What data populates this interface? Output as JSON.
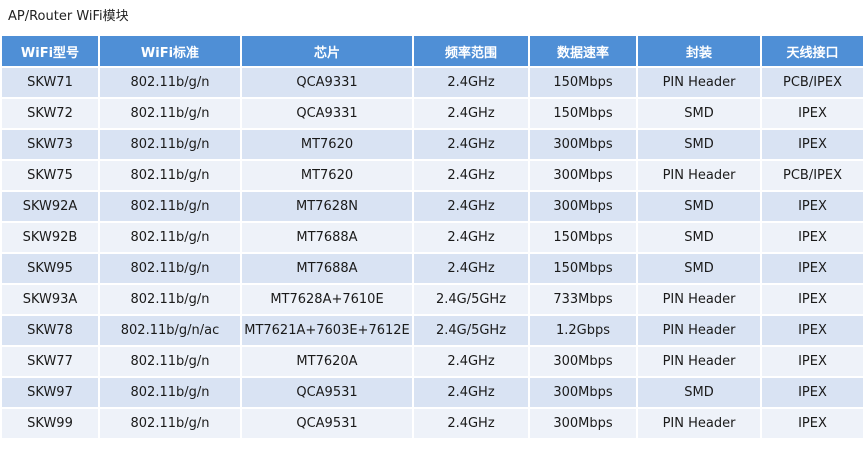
{
  "title": "AP/Router WiFi模块",
  "table": {
    "columns": [
      "WiFi型号",
      "WiFi标准",
      "芯片",
      "频率范围",
      "数据速率",
      "封装",
      "天线接口"
    ],
    "rows": [
      [
        "SKW71",
        "802.11b/g/n",
        "QCA9331",
        "2.4GHz",
        "150Mbps",
        "PIN Header",
        "PCB/IPEX"
      ],
      [
        "SKW72",
        "802.11b/g/n",
        "QCA9331",
        "2.4GHz",
        "150Mbps",
        "SMD",
        "IPEX"
      ],
      [
        "SKW73",
        "802.11b/g/n",
        "MT7620",
        "2.4GHz",
        "300Mbps",
        "SMD",
        "IPEX"
      ],
      [
        "SKW75",
        "802.11b/g/n",
        "MT7620",
        "2.4GHz",
        "300Mbps",
        "PIN Header",
        "PCB/IPEX"
      ],
      [
        "SKW92A",
        "802.11b/g/n",
        "MT7628N",
        "2.4GHz",
        "300Mbps",
        "SMD",
        "IPEX"
      ],
      [
        "SKW92B",
        "802.11b/g/n",
        "MT7688A",
        "2.4GHz",
        "150Mbps",
        "SMD",
        "IPEX"
      ],
      [
        "SKW95",
        "802.11b/g/n",
        "MT7688A",
        "2.4GHz",
        "150Mbps",
        "SMD",
        "IPEX"
      ],
      [
        "SKW93A",
        "802.11b/g/n",
        "MT7628A+7610E",
        "2.4G/5GHz",
        "733Mbps",
        "PIN Header",
        "IPEX"
      ],
      [
        "SKW78",
        "802.11b/g/n/ac",
        "MT7621A+7603E+7612E",
        "2.4G/5GHz",
        "1.2Gbps",
        "PIN Header",
        "IPEX"
      ],
      [
        "SKW77",
        "802.11b/g/n",
        "MT7620A",
        "2.4GHz",
        "300Mbps",
        "PIN Header",
        "IPEX"
      ],
      [
        "SKW97",
        "802.11b/g/n",
        "QCA9531",
        "2.4GHz",
        "300Mbps",
        "SMD",
        "IPEX"
      ],
      [
        "SKW99",
        "802.11b/g/n",
        "QCA9531",
        "2.4GHz",
        "300Mbps",
        "PIN Header",
        "IPEX"
      ]
    ]
  },
  "colors": {
    "header_bg": "#4f8fd6",
    "row_odd": "#d9e3f3",
    "row_even": "#eef2f9"
  }
}
